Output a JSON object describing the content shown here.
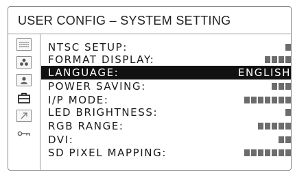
{
  "header": {
    "title": "USER CONFIG – SYSTEM SETTING"
  },
  "sidebar": {
    "icons": [
      {
        "name": "status-grid-icon"
      },
      {
        "name": "color-dots-icon"
      },
      {
        "name": "user-profile-icon"
      },
      {
        "name": "toolbox-icon"
      },
      {
        "name": "external-link-icon"
      },
      {
        "name": "key-icon"
      }
    ]
  },
  "menu": {
    "selected_index": 2,
    "items": [
      {
        "label": "NTSC SETUP:",
        "value": "",
        "level_blocks": 1
      },
      {
        "label": "FORMAT DISPLAY:",
        "value": "",
        "level_blocks": 4
      },
      {
        "label": "LANGUAGE:",
        "value": "ENGLISH",
        "level_blocks": 0
      },
      {
        "label": "POWER SAVING:",
        "value": "",
        "level_blocks": 3
      },
      {
        "label": "I/P MODE:",
        "value": "",
        "level_blocks": 7
      },
      {
        "label": "LED BRIGHTNESS:",
        "value": "",
        "level_blocks": 1
      },
      {
        "label": "RGB RANGE:",
        "value": "",
        "level_blocks": 5
      },
      {
        "label": "DVI:",
        "value": "",
        "level_blocks": 2
      },
      {
        "label": "SD PIXEL MAPPING:",
        "value": "",
        "level_blocks": 7
      }
    ]
  }
}
